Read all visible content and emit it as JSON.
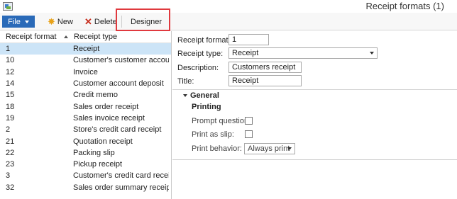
{
  "window": {
    "title": "Receipt formats (1)"
  },
  "toolbar": {
    "file_label": "File",
    "new_label": "New",
    "delete_label": "Delete",
    "designer_label": "Designer"
  },
  "list": {
    "headers": {
      "format": "Receipt format",
      "type": "Receipt type"
    },
    "rows": [
      {
        "format": "1",
        "type": "Receipt"
      },
      {
        "format": "10",
        "type": "Customer's customer account rec"
      },
      {
        "format": "12",
        "type": "Invoice"
      },
      {
        "format": "14",
        "type": "Customer account deposit"
      },
      {
        "format": "15",
        "type": "Credit memo"
      },
      {
        "format": "18",
        "type": "Sales order receipt"
      },
      {
        "format": "19",
        "type": "Sales invoice receipt"
      },
      {
        "format": "2",
        "type": "Store's credit card receipt"
      },
      {
        "format": "21",
        "type": "Quotation receipt"
      },
      {
        "format": "22",
        "type": "Packing slip"
      },
      {
        "format": "23",
        "type": "Pickup receipt"
      },
      {
        "format": "3",
        "type": "Customer's credit card receipt"
      },
      {
        "format": "32",
        "type": "Sales order summary receipt"
      }
    ],
    "selected_index": 0
  },
  "details": {
    "receipt_format_label": "Receipt format:",
    "receipt_format_value": "1",
    "receipt_type_label": "Receipt type:",
    "receipt_type_value": "Receipt",
    "description_label": "Description:",
    "description_value": "Customers receipt",
    "title_label": "Title:",
    "title_value": "Receipt"
  },
  "general": {
    "heading": "General",
    "subheading": "Printing",
    "prompt_question_label": "Prompt question:",
    "prompt_question_checked": false,
    "print_as_slip_label": "Print as slip:",
    "print_as_slip_checked": false,
    "print_behavior_label": "Print behavior:",
    "print_behavior_value": "Always print"
  },
  "colors": {
    "file_button": "#2a6ab8",
    "selected_row": "#cce4f7",
    "highlight": "#e0393e"
  }
}
